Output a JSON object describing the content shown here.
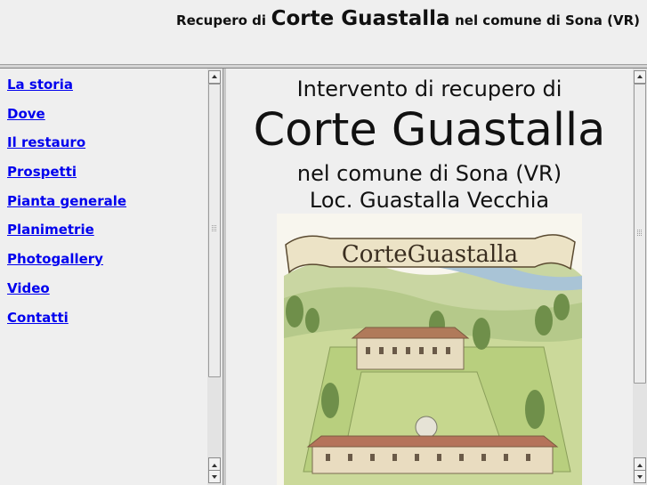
{
  "header": {
    "prefix": "Recupero di",
    "name": "Corte Guastalla",
    "suffix": "nel comune di Sona (VR)"
  },
  "nav": {
    "items": [
      {
        "label": "La storia"
      },
      {
        "label": "Dove"
      },
      {
        "label": "Il restauro"
      },
      {
        "label": "Prospetti"
      },
      {
        "label": "Pianta generale"
      },
      {
        "label": "Planimetrie"
      },
      {
        "label": "Photogallery"
      },
      {
        "label": "Video"
      },
      {
        "label": "Contatti"
      }
    ]
  },
  "main": {
    "intro": "Intervento di recupero di",
    "title": "Corte Guastalla",
    "comune": "nel comune di Sona (VR)",
    "location": "Loc. Guastalla Vecchia",
    "illustration_banner": "CorteGuastalla"
  },
  "colors": {
    "link": "#0000ee",
    "background": "#efefef"
  }
}
